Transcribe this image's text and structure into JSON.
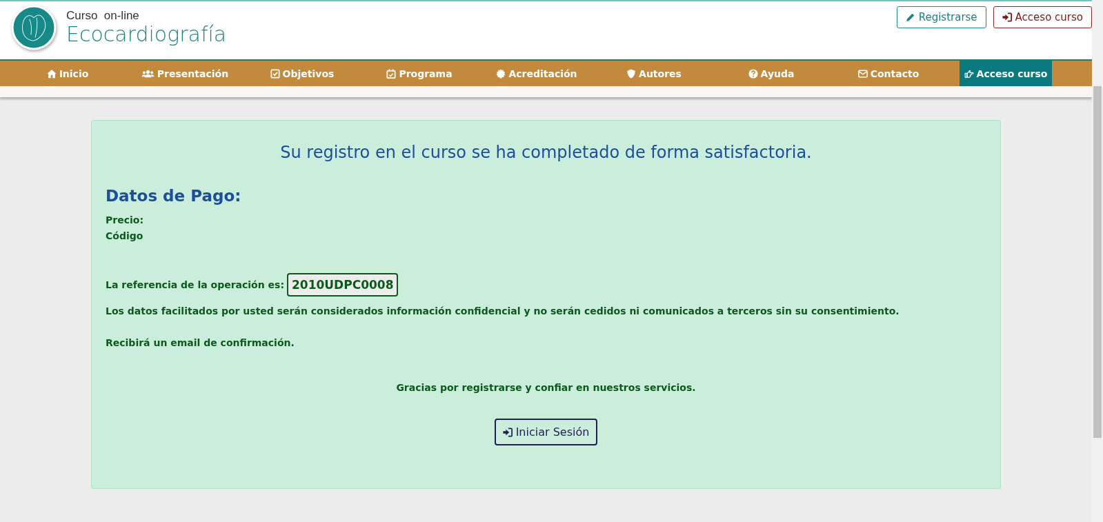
{
  "header": {
    "subtitle": "Curso  on-line",
    "title": "Ecocardiografía",
    "buttons": [
      {
        "label": "Registrarse",
        "kind": "pencil"
      },
      {
        "label": "Acceso curso",
        "kind": "signin"
      }
    ]
  },
  "nav": [
    {
      "label": "Inicio",
      "selected": false
    },
    {
      "label": "Presentación",
      "selected": false
    },
    {
      "label": "Objetivos",
      "selected": false
    },
    {
      "label": "Programa",
      "selected": false
    },
    {
      "label": "Acreditación",
      "selected": false
    },
    {
      "label": "Autores",
      "selected": false
    },
    {
      "label": "Ayuda",
      "selected": false
    },
    {
      "label": "Contacto",
      "selected": false
    },
    {
      "label": "Acceso curso",
      "selected": true
    }
  ],
  "card": {
    "heading": "Su registro en el curso se ha completado de forma satisfactoria.",
    "payment_title": "Datos de Pago:",
    "price_label": "Precio:",
    "code_label": "Código",
    "reference_label": "La referencia de la operación es:",
    "reference": "2010UDPC0008",
    "privacy_note": "Los datos facilitados por usted serán considerados información confidencial y no serán cedidos ni comunicados a terceros sin su consentimiento.",
    "email_note": "Recibirá un email de confirmación.",
    "thanks": "Gracias por registrarse y confiar en nuestros servicios.",
    "login_button": "Iniciar Sesión"
  }
}
